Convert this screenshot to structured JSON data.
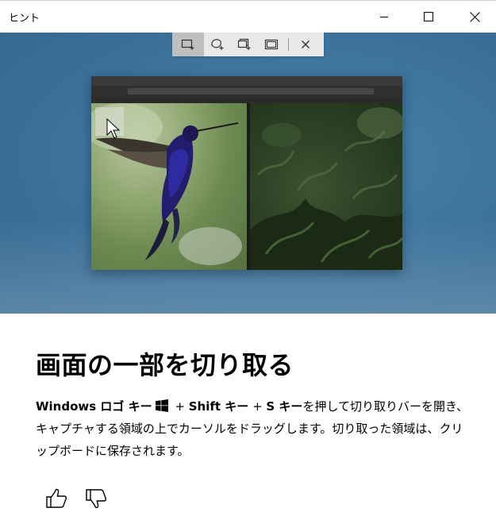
{
  "window": {
    "title": "ヒント",
    "minimize_icon": "minimize-icon",
    "maximize_icon": "maximize-icon",
    "close_icon": "close-icon"
  },
  "snip_toolbar": {
    "tools": [
      {
        "name": "rectangular-snip-icon",
        "active": true
      },
      {
        "name": "freeform-snip-icon",
        "active": false
      },
      {
        "name": "window-snip-icon",
        "active": false
      },
      {
        "name": "fullscreen-snip-icon",
        "active": false
      },
      {
        "name": "close-icon",
        "active": false
      }
    ]
  },
  "illustration": {
    "left_image": "hummingbird",
    "right_image": "jungle-foliage",
    "cursor_icon": "mouse-pointer-icon"
  },
  "tip": {
    "heading": "画面の一部を切り取る",
    "key_windows": "Windows ロゴ キー",
    "plus1": " + ",
    "key_shift": "Shift キー",
    "plus2": " + ",
    "key_s": "S キー",
    "body": "を押して切り取りバーを開き、キャプチャする領域の上でカーソルをドラッグします。切り取った領域は、クリップボードに保存されます。"
  },
  "feedback": {
    "like_icon": "thumbs-up-icon",
    "dislike_icon": "thumbs-down-icon"
  },
  "colors": {
    "hero_bg": "#3f77a0",
    "toolbar_bg": "#e8e8e8",
    "toolbar_active": "#bfbfbf"
  }
}
